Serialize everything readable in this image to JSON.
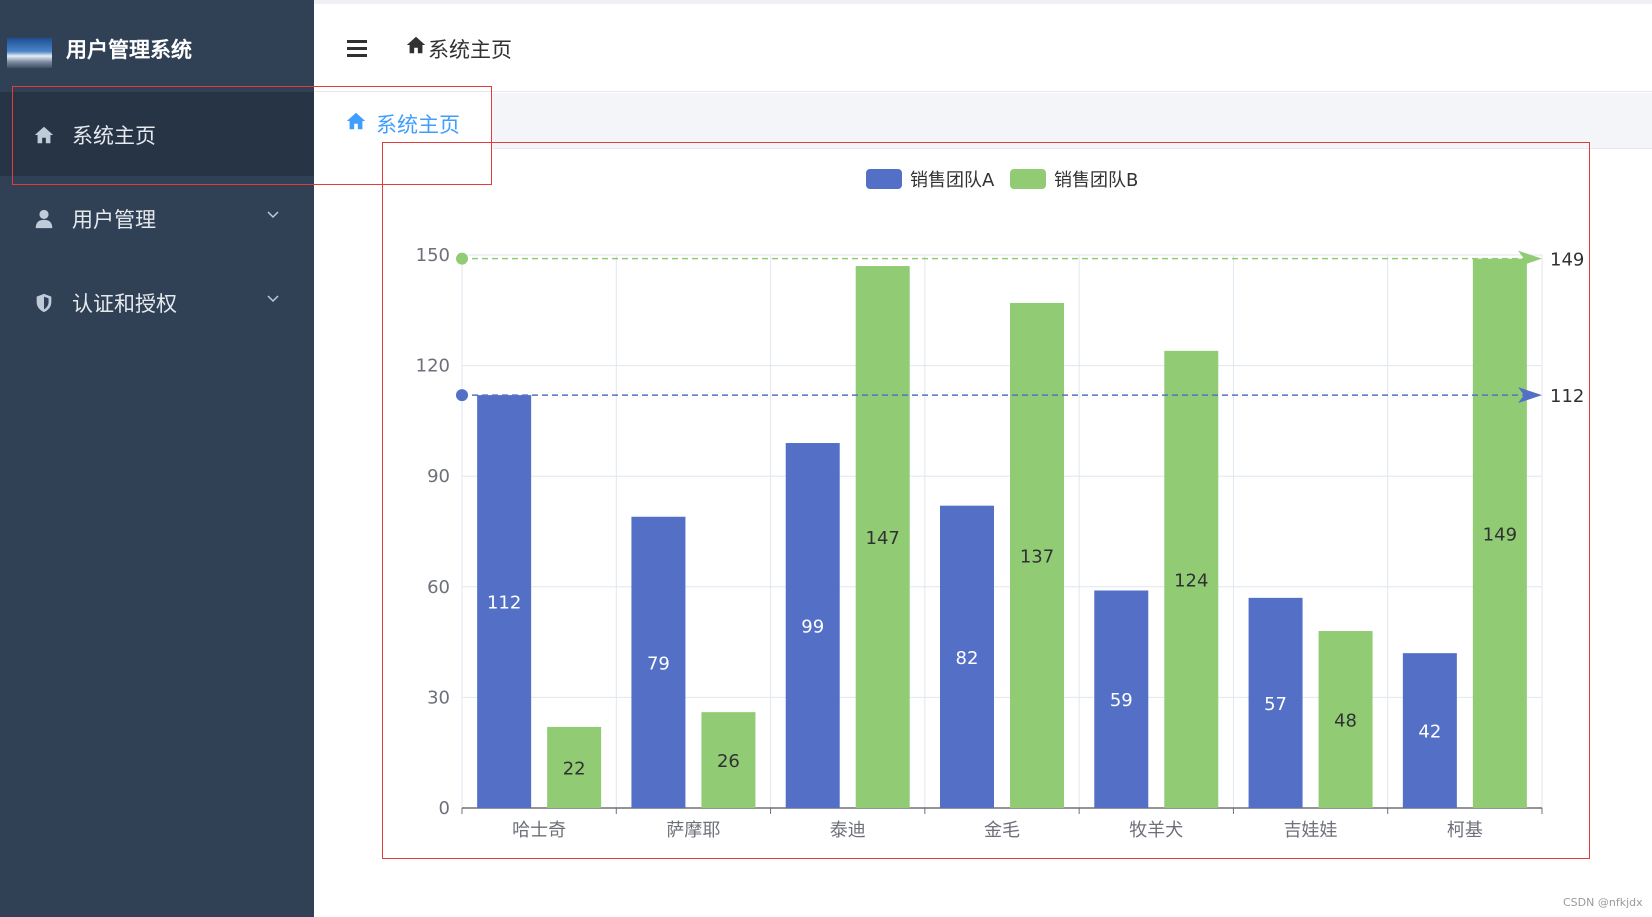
{
  "sidebar": {
    "brand_title": "用户管理系统",
    "items": [
      {
        "label": "系统主页",
        "icon": "home-icon",
        "active": true,
        "has_submenu": false
      },
      {
        "label": "用户管理",
        "icon": "user-icon",
        "active": false,
        "has_submenu": true
      },
      {
        "label": "认证和授权",
        "icon": "shield-icon",
        "active": false,
        "has_submenu": true
      }
    ]
  },
  "header": {
    "breadcrumb": "系统主页"
  },
  "tags": {
    "active_tag": "系统主页"
  },
  "colors": {
    "sidebar_bg": "#304156",
    "active_item_bg": "#263445",
    "accent": "#409eff",
    "series_a": "#5470c6",
    "series_b": "#91cc75",
    "highlight_border": "#e23c3c"
  },
  "chart_data": {
    "type": "bar",
    "categories": [
      "哈士奇",
      "萨摩耶",
      "泰迪",
      "金毛",
      "牧羊犬",
      "吉娃娃",
      "柯基"
    ],
    "series": [
      {
        "name": "销售团队A",
        "values": [
          112,
          79,
          99,
          82,
          59,
          57,
          42
        ],
        "color": "#5470c6",
        "max_line": 112
      },
      {
        "name": "销售团队B",
        "values": [
          22,
          26,
          147,
          137,
          124,
          48,
          149
        ],
        "color": "#91cc75",
        "max_line": 149
      }
    ],
    "y_ticks": [
      0,
      30,
      60,
      90,
      120,
      150
    ],
    "ylim": [
      0,
      150
    ],
    "grid": true,
    "legend_position": "top-center",
    "data_labels": "inside"
  },
  "watermark": "CSDN @nfkjdx"
}
